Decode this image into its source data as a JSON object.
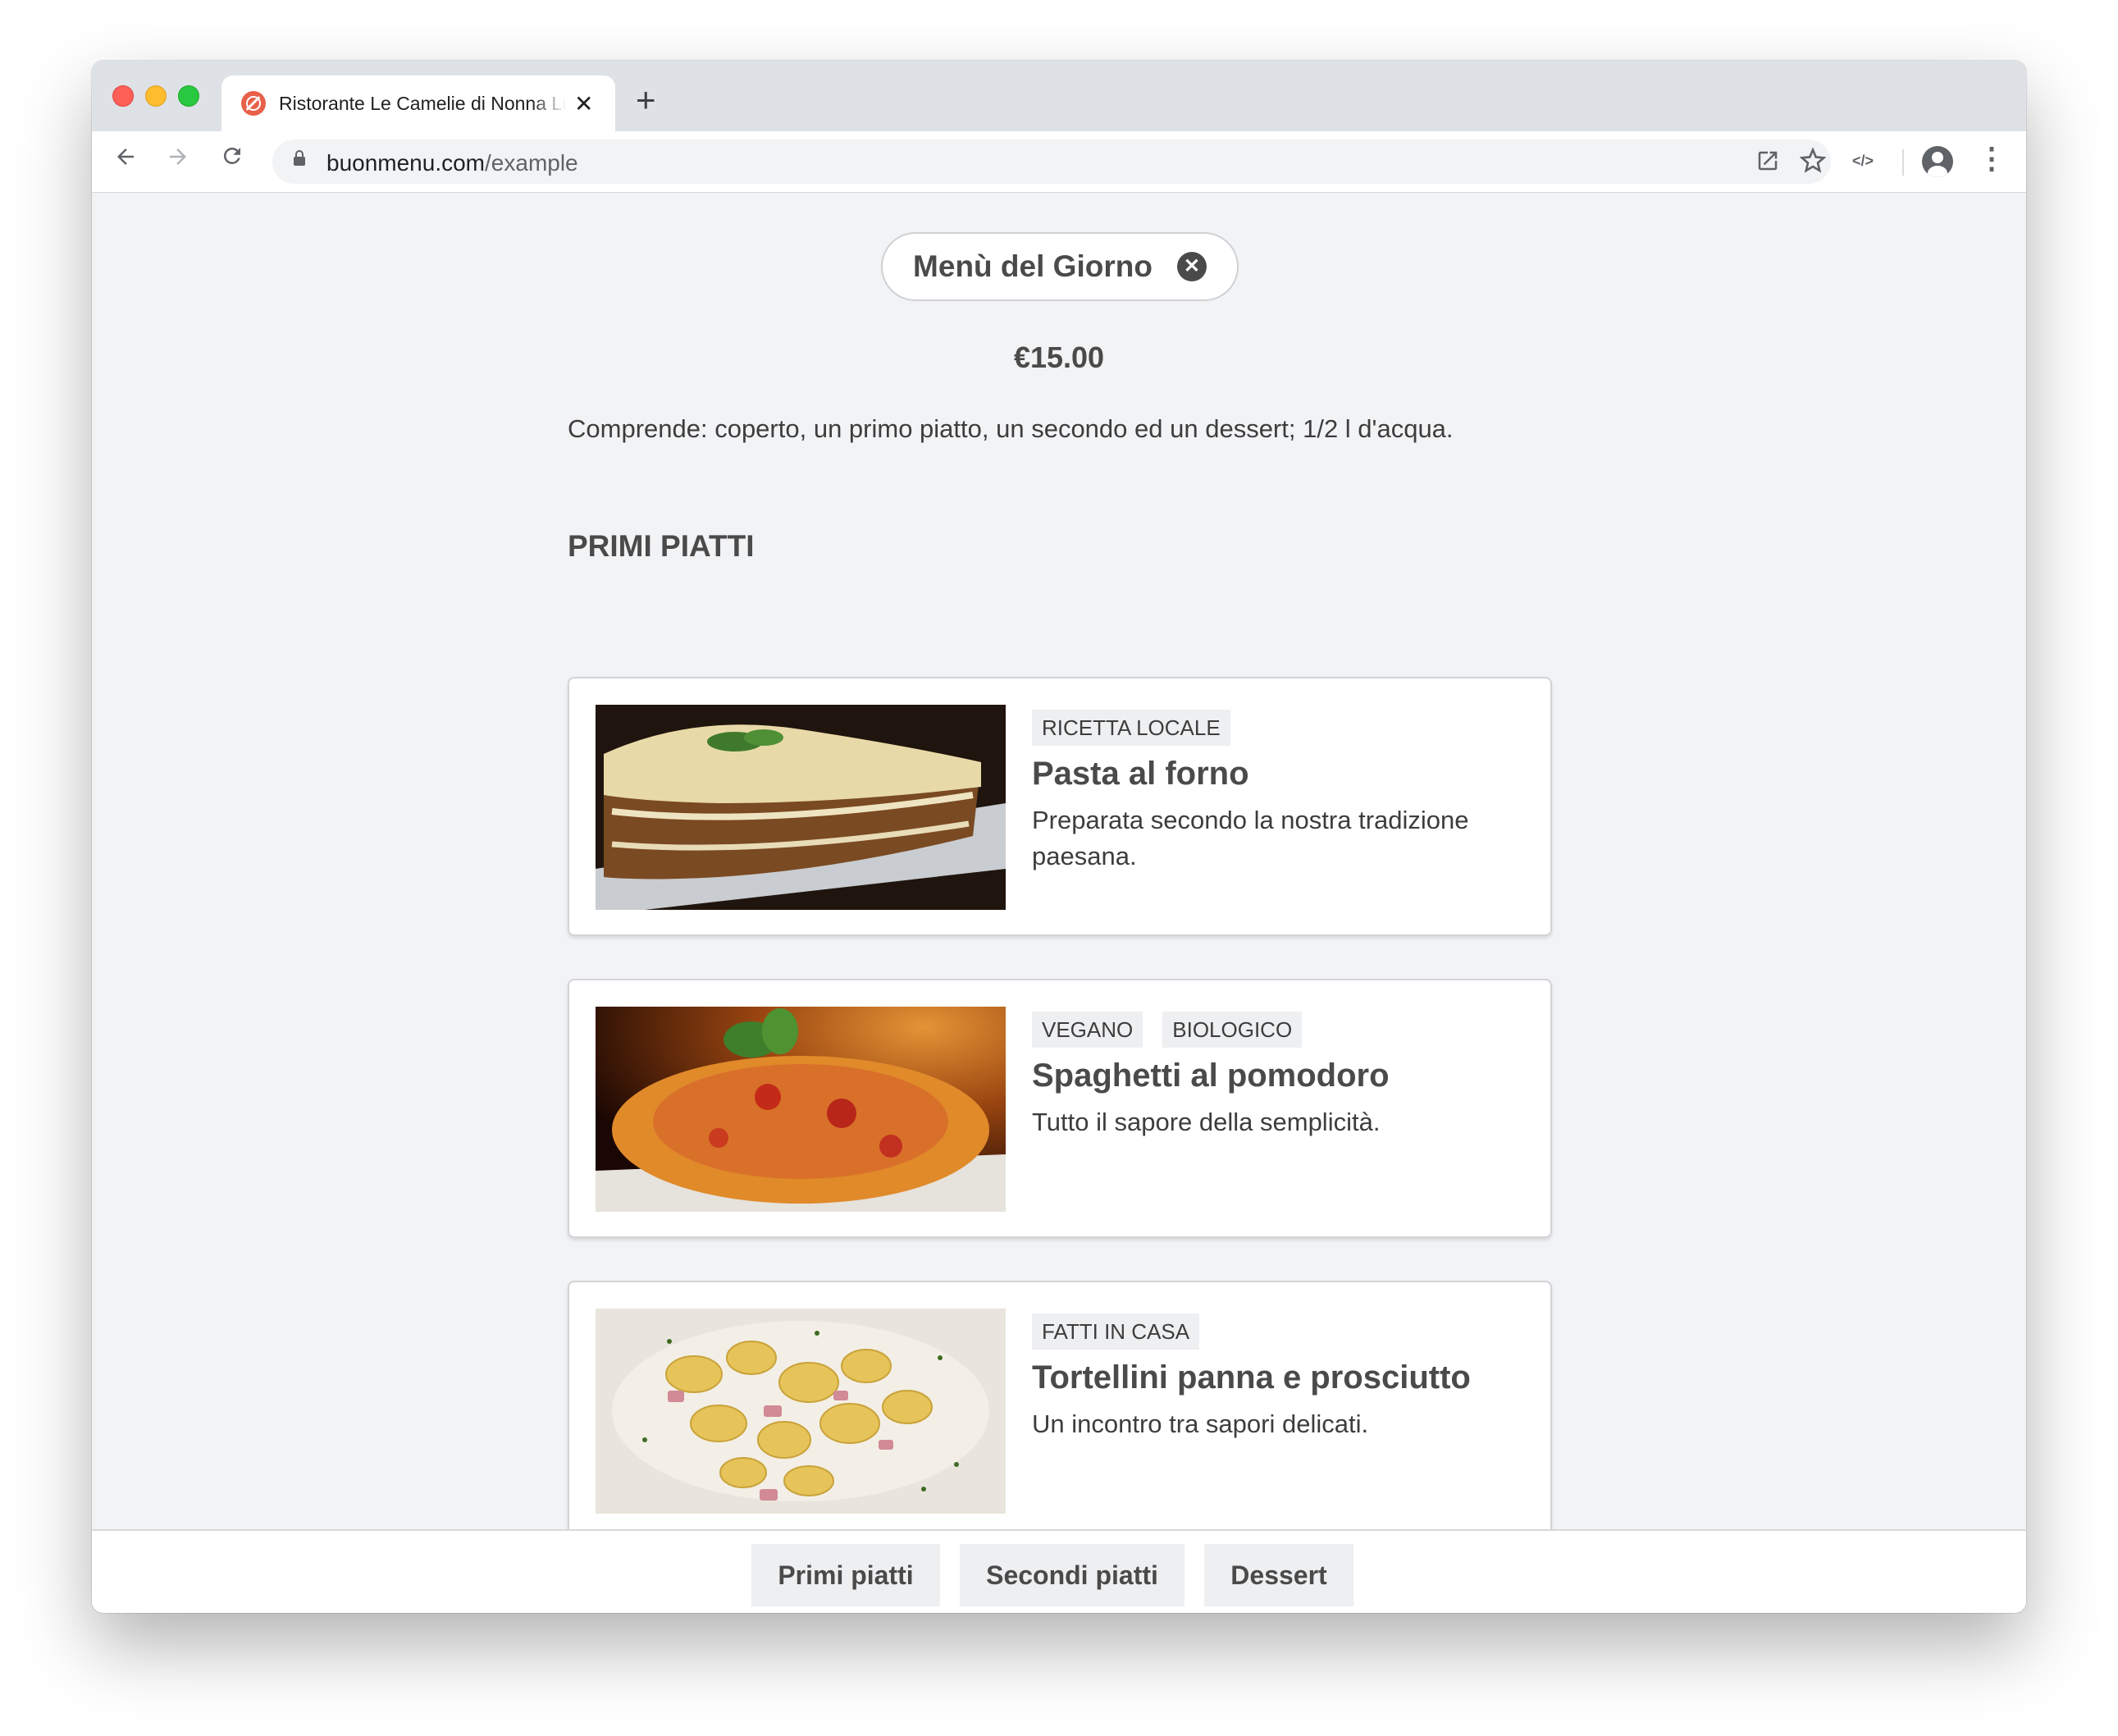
{
  "browser": {
    "tab_title": "Ristorante Le Camelie di Nonna Lucia",
    "url_domain": "buonmenu.com",
    "url_path": "/example",
    "code_icon_text": "</>"
  },
  "menu": {
    "title": "Menù del Giorno",
    "price": "€15.00",
    "description": "Comprende: coperto, un primo piatto, un secondo ed un dessert; 1/2 l d'acqua."
  },
  "section": {
    "title": "PRIMI PIATTI",
    "dishes": [
      {
        "tags": [
          "RICETTA LOCALE"
        ],
        "name": "Pasta al forno",
        "description": "Preparata secondo la nostra tradizione paesana."
      },
      {
        "tags": [
          "VEGANO",
          "BIOLOGICO"
        ],
        "name": "Spaghetti al pomodoro",
        "description": "Tutto il sapore della semplicità."
      },
      {
        "tags": [
          "FATTI IN CASA"
        ],
        "name": "Tortellini panna e prosciutto",
        "description": "Un incontro tra sapori delicati."
      }
    ]
  },
  "bottom_nav": {
    "items": [
      "Primi piatti",
      "Secondi piatti",
      "Dessert"
    ]
  },
  "icons": {
    "back": "arrow-left-icon",
    "forward": "arrow-right-icon",
    "reload": "reload-icon",
    "lock": "lock-icon",
    "open_external": "open-external-icon",
    "star": "star-icon",
    "code": "code-icon",
    "account": "account-icon",
    "more": "more-vert-icon",
    "close_menu": "close-circle-icon"
  },
  "colors": {
    "page_background": "#f2f3f5",
    "text_primary": "#4a4a4a",
    "tag_background": "#eeeff1"
  }
}
